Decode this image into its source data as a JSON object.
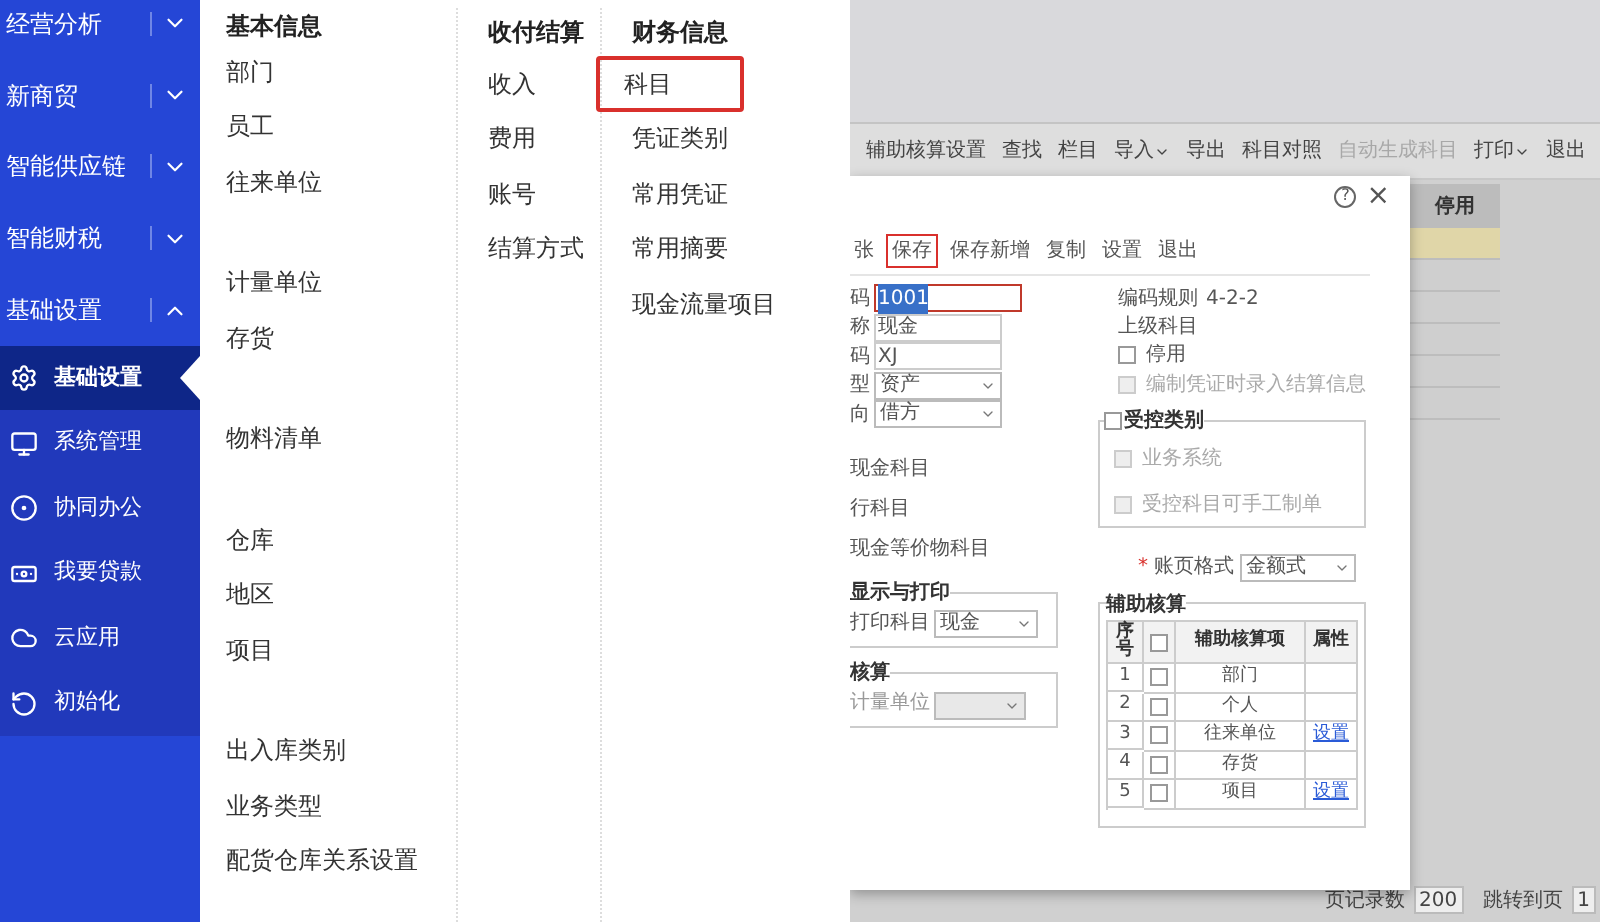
{
  "sidebar": {
    "groups": [
      {
        "label": "经营分析",
        "expanded": false
      },
      {
        "label": "新商贸",
        "expanded": false
      },
      {
        "label": "智能供应链",
        "expanded": false
      },
      {
        "label": "智能财税",
        "expanded": false
      },
      {
        "label": "基础设置",
        "expanded": true
      }
    ],
    "subitems": [
      {
        "label": "基础设置",
        "kind": "gear",
        "selected": true
      },
      {
        "label": "系统管理",
        "kind": "monitor",
        "selected": false
      },
      {
        "label": "协同办公",
        "kind": "ring",
        "selected": false
      },
      {
        "label": "我要贷款",
        "kind": "cash",
        "selected": false
      },
      {
        "label": "云应用",
        "kind": "cloud",
        "selected": false
      },
      {
        "label": "初始化",
        "kind": "reset",
        "selected": false
      }
    ]
  },
  "menu": {
    "columns": [
      {
        "title": "基本信息",
        "groups": [
          [
            {
              "label": "部门",
              "selected": false
            },
            {
              "label": "员工",
              "selected": false
            },
            {
              "label": "往来单位",
              "selected": false
            }
          ],
          [
            {
              "label": "计量单位",
              "selected": false
            },
            {
              "label": "存货",
              "selected": false
            }
          ],
          [
            {
              "label": "物料清单",
              "selected": false
            }
          ],
          [
            {
              "label": "仓库",
              "selected": false
            },
            {
              "label": "地区",
              "selected": false
            },
            {
              "label": "项目",
              "selected": false
            }
          ],
          [
            {
              "label": "出入库类别",
              "selected": false
            },
            {
              "label": "业务类型",
              "selected": false
            },
            {
              "label": "配货仓库关系设置",
              "selected": false
            }
          ]
        ]
      },
      {
        "title": "收付结算",
        "groups": [
          [
            {
              "label": "收入",
              "selected": false
            },
            {
              "label": "费用",
              "selected": false
            },
            {
              "label": "账号",
              "selected": false
            },
            {
              "label": "结算方式",
              "selected": false
            }
          ]
        ]
      },
      {
        "title": "财务信息",
        "groups": [
          [
            {
              "label": "科目",
              "selected": true
            },
            {
              "label": "凭证类别",
              "selected": false
            },
            {
              "label": "常用凭证",
              "selected": false
            },
            {
              "label": "常用摘要",
              "selected": false
            },
            {
              "label": "现金流量项目",
              "selected": false
            }
          ]
        ]
      }
    ]
  },
  "toolbar": [
    {
      "label": "辅助核算设置",
      "dropdown": false,
      "disabled": false
    },
    {
      "label": "查找",
      "dropdown": false,
      "disabled": false
    },
    {
      "label": "栏目",
      "dropdown": false,
      "disabled": false
    },
    {
      "label": "导入",
      "dropdown": true,
      "disabled": false
    },
    {
      "label": "导出",
      "dropdown": false,
      "disabled": false
    },
    {
      "label": "科目对照",
      "dropdown": false,
      "disabled": false
    },
    {
      "label": "自动生成科目",
      "dropdown": false,
      "disabled": true
    },
    {
      "label": "打印",
      "dropdown": true,
      "disabled": false
    },
    {
      "label": "退出",
      "dropdown": false,
      "disabled": false
    }
  ],
  "table": {
    "column": "停用",
    "rows": [
      {
        "selected": true
      },
      {
        "selected": false
      },
      {
        "selected": false
      },
      {
        "selected": false
      },
      {
        "selected": false
      },
      {
        "selected": false
      }
    ]
  },
  "pager": {
    "page_size_label": "页记录数",
    "page_size": "200",
    "jump_label": "跳转到页",
    "page": "1"
  },
  "dialog": {
    "help": "?",
    "close": "×",
    "actions": [
      {
        "label": "张",
        "selected": false
      },
      {
        "label": "保存",
        "selected": true
      },
      {
        "label": "保存新增",
        "selected": false
      },
      {
        "label": "复制",
        "selected": false
      },
      {
        "label": "设置",
        "selected": false
      },
      {
        "label": "退出",
        "selected": false
      }
    ],
    "fields": [
      {
        "label": "码",
        "value": "1001",
        "kind": "input",
        "focused": true
      },
      {
        "label": "称",
        "value": "现金",
        "kind": "input",
        "focused": false
      },
      {
        "label": "码",
        "value": "XJ",
        "kind": "input",
        "focused": false
      },
      {
        "label": "型",
        "value": "资产",
        "kind": "select",
        "focused": false
      },
      {
        "label": "向",
        "value": "借方",
        "kind": "select",
        "focused": false
      }
    ],
    "flags": [
      "现金科目",
      "行科目",
      "现金等价物科目"
    ],
    "code_rule_label": "编码规则",
    "code_rule": "4-2-2",
    "parent_label": "上级科目",
    "options": [
      {
        "label": "停用",
        "checked": false,
        "disabled": false
      },
      {
        "label": "编制凭证时录入结算信息",
        "checked": false,
        "disabled": true
      }
    ],
    "controlled": {
      "label": "受控类别",
      "checked": false,
      "items": [
        {
          "label": "业务系统",
          "checked": false,
          "disabled": true
        },
        {
          "label": "受控科目可手工制单",
          "checked": false,
          "disabled": true
        }
      ]
    },
    "display": {
      "legend": "显示与打印",
      "label": "打印科目",
      "value": "现金"
    },
    "quantity": {
      "legend": "核算",
      "label": "计量单位",
      "disabled": true
    },
    "ledger": {
      "required": "*",
      "label": "账页格式",
      "value": "金额式"
    },
    "aux": {
      "legend": "辅助核算",
      "all_checked": false,
      "columns": [
        "序号",
        "辅助核算项",
        "属性"
      ],
      "rows": [
        {
          "no": "1",
          "item": "部门",
          "checked": false
        },
        {
          "no": "2",
          "item": "个人",
          "checked": false
        },
        {
          "no": "3",
          "item": "往来单位",
          "link": "设置",
          "checked": false
        },
        {
          "no": "4",
          "item": "存货",
          "checked": false
        },
        {
          "no": "5",
          "item": "项目",
          "link": "设置",
          "checked": false
        }
      ]
    }
  }
}
